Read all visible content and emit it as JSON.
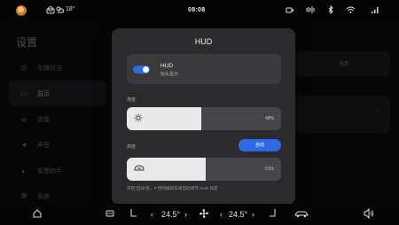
{
  "status_bar": {
    "temperature": "18°",
    "time": "08:08",
    "icons": [
      "avatar",
      "lock-icon",
      "cloud-sun-icon",
      "camera-icon",
      "sound-icon",
      "bluetooth-icon",
      "wifi-icon",
      "signal-icon"
    ]
  },
  "background": {
    "title": "设置",
    "menu": [
      {
        "label": "车辆状况",
        "icon": "car-icon"
      },
      {
        "label": "显示",
        "icon": "display-icon"
      },
      {
        "label": "连接",
        "icon": "link-icon"
      },
      {
        "label": "声音",
        "icon": "speaker-icon"
      },
      {
        "label": "智慧助手",
        "icon": "assistant-icon"
      },
      {
        "label": "系统",
        "icon": "gear-icon"
      }
    ],
    "right_tab": "浅色"
  },
  "modal": {
    "title": "HUD",
    "hud_toggle": {
      "label": "HUD",
      "sub": "抬头显示",
      "on": true
    },
    "brightness": {
      "label": "亮度",
      "percent_text": "48%",
      "value": 48
    },
    "height": {
      "label": "高度",
      "auto_label": "自动",
      "percent_text": "51%",
      "value": 51
    },
    "note": "开启“自动”后，P 挡时踩刹车将自动调节 HUD 高度"
  },
  "dock": {
    "left_temp": "24.5°",
    "right_temp": "24.5°"
  },
  "colors": {
    "accent": "#2d6be6",
    "modal_bg": "#2b2b2e"
  }
}
